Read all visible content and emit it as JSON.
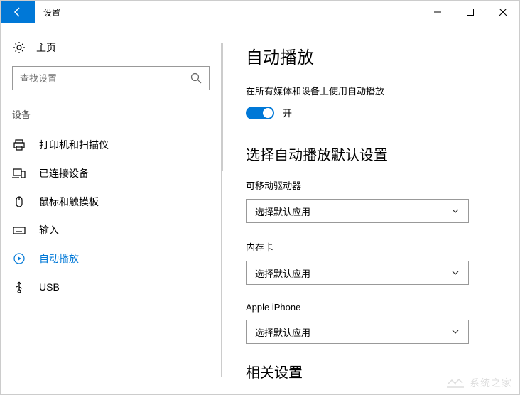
{
  "titlebar": {
    "title": "设置"
  },
  "sidebar": {
    "home_label": "主页",
    "search_placeholder": "查找设置",
    "section_label": "设备",
    "items": [
      {
        "label": "打印机和扫描仪"
      },
      {
        "label": "已连接设备"
      },
      {
        "label": "鼠标和触摸板"
      },
      {
        "label": "输入"
      },
      {
        "label": "自动播放"
      },
      {
        "label": "USB"
      }
    ]
  },
  "content": {
    "heading": "自动播放",
    "toggle_label": "在所有媒体和设备上使用自动播放",
    "toggle_state": "开",
    "section_heading": "选择自动播放默认设置",
    "fields": [
      {
        "label": "可移动驱动器",
        "value": "选择默认应用"
      },
      {
        "label": "内存卡",
        "value": "选择默认应用"
      },
      {
        "label": "Apple iPhone",
        "value": "选择默认应用"
      }
    ],
    "related_heading": "相关设置"
  },
  "watermark": "系统之家"
}
